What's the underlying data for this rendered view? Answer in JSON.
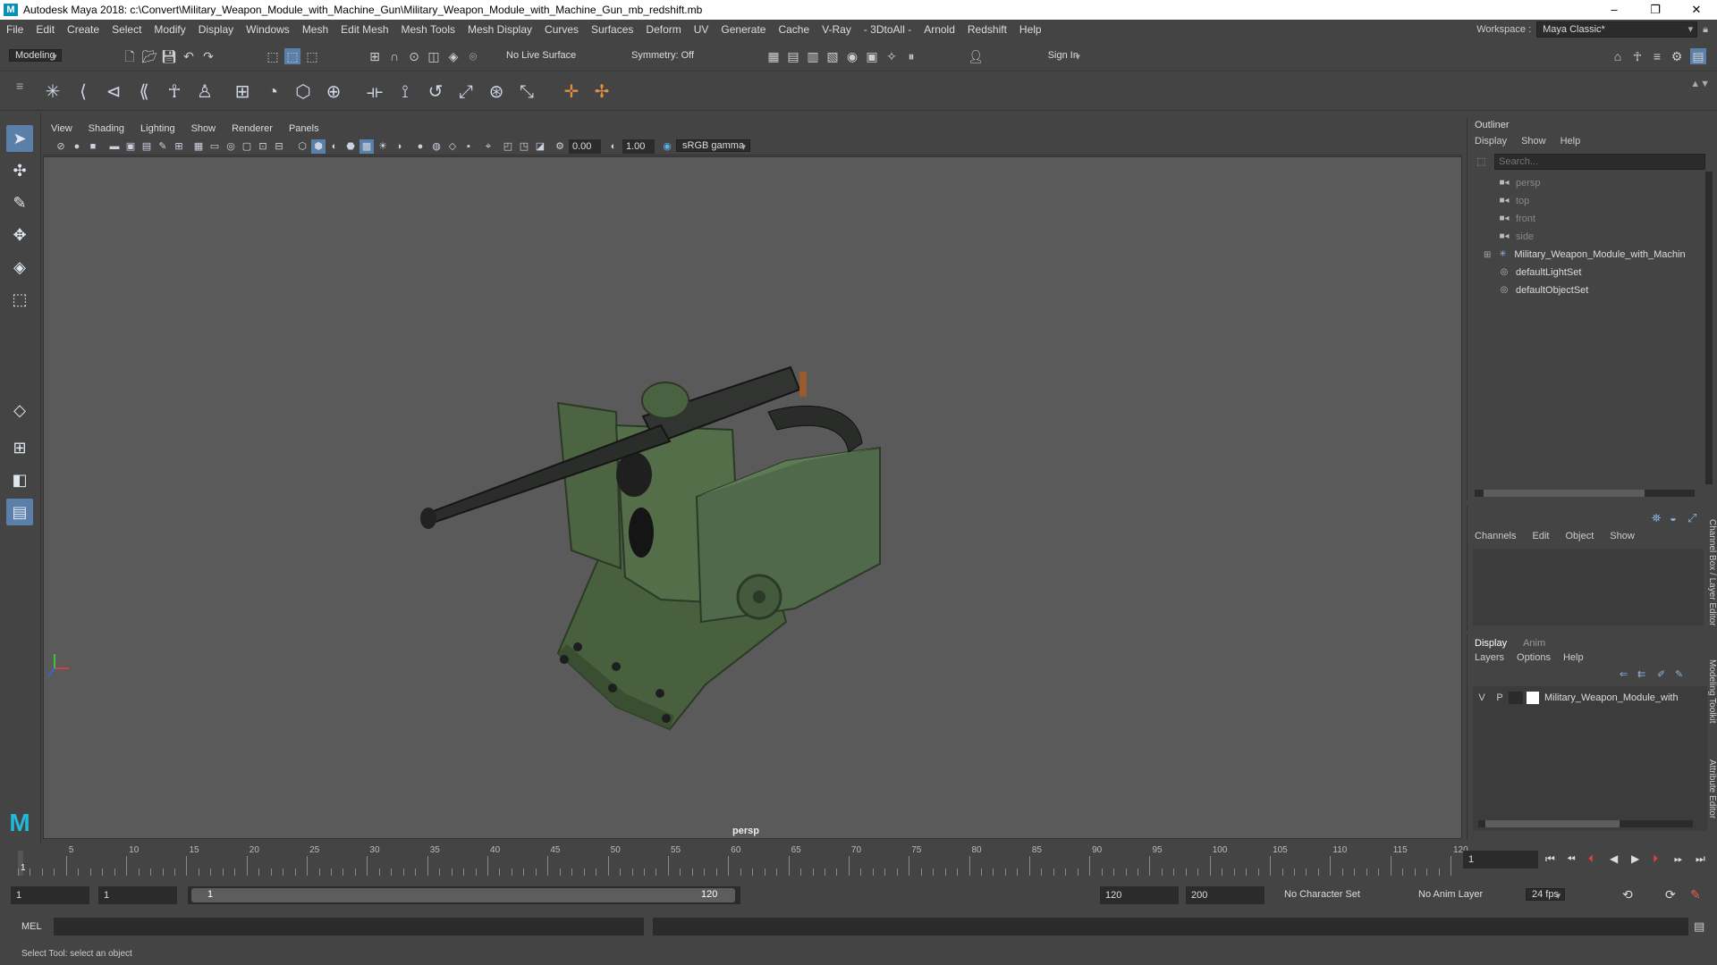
{
  "window": {
    "title": "Autodesk Maya 2018: c:\\Convert\\Military_Weapon_Module_with_Machine_Gun\\Military_Weapon_Module_with_Machine_Gun_mb_redshift.mb",
    "logo": "M"
  },
  "menubar": {
    "items": [
      "File",
      "Edit",
      "Create",
      "Select",
      "Modify",
      "Display",
      "Windows",
      "Mesh",
      "Edit Mesh",
      "Mesh Tools",
      "Mesh Display",
      "Curves",
      "Surfaces",
      "Deform",
      "UV",
      "Generate",
      "Cache",
      "V-Ray",
      "- 3DtoAll -",
      "Arnold",
      "Redshift",
      "Help"
    ],
    "workspace_label": "Workspace :",
    "workspace_value": "Maya Classic*"
  },
  "statusline": {
    "mode": "Modeling",
    "live_surface": "No Live Surface",
    "symmetry": "Symmetry: Off",
    "sign_in": "Sign In"
  },
  "viewport": {
    "menus": [
      "View",
      "Shading",
      "Lighting",
      "Show",
      "Renderer",
      "Panels"
    ],
    "exposure": "0.00",
    "gamma": "1.00",
    "color_space": "sRGB gamma",
    "camera_label": "persp"
  },
  "outliner": {
    "title": "Outliner",
    "menus": [
      "Display",
      "Show",
      "Help"
    ],
    "search_placeholder": "Search...",
    "items": [
      {
        "label": "persp",
        "icon": "camera-icon",
        "dim": true
      },
      {
        "label": "top",
        "icon": "camera-icon",
        "dim": true
      },
      {
        "label": "front",
        "icon": "camera-icon",
        "dim": true
      },
      {
        "label": "side",
        "icon": "camera-icon",
        "dim": true
      },
      {
        "label": "Military_Weapon_Module_with_Machin",
        "icon": "group-icon",
        "dim": false
      },
      {
        "label": "defaultLightSet",
        "icon": "set-icon",
        "dim": false
      },
      {
        "label": "defaultObjectSet",
        "icon": "set-icon",
        "dim": false
      }
    ]
  },
  "channel_box": {
    "menus": [
      "Channels",
      "Edit",
      "Object",
      "Show"
    ]
  },
  "layer_editor": {
    "tabs": [
      "Display",
      "Anim"
    ],
    "menus": [
      "Layers",
      "Options",
      "Help"
    ],
    "layer": {
      "v": "V",
      "p": "P",
      "name": "Military_Weapon_Module_with"
    }
  },
  "side_tabs": [
    "Channel Box / Layer Editor",
    "Modeling Toolkit",
    "Attribute Editor"
  ],
  "timeline": {
    "ticks": [
      "5",
      "10",
      "15",
      "20",
      "25",
      "30",
      "35",
      "40",
      "45",
      "50",
      "55",
      "60",
      "65",
      "70",
      "75",
      "80",
      "85",
      "90",
      "95",
      "100",
      "105",
      "110",
      "115",
      "120"
    ],
    "current_marker": "1",
    "current_frame": "1"
  },
  "range": {
    "start": "1",
    "playback_start": "1",
    "slider_start": "1",
    "slider_end": "120",
    "playback_end": "120",
    "end": "200",
    "character_set": "No Character Set",
    "anim_layer": "No Anim Layer",
    "fps": "24 fps"
  },
  "command": {
    "language": "MEL",
    "help_text": "Select Tool: select an object"
  }
}
